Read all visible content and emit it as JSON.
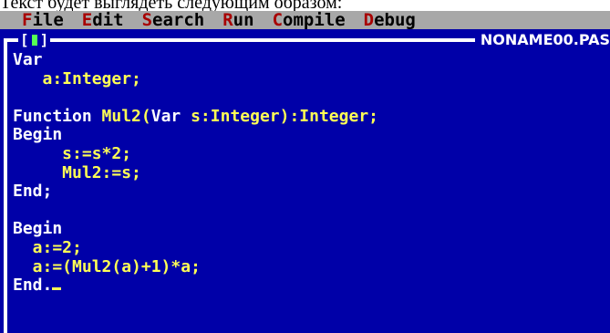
{
  "caption": "Текст будет выглядеть следующим образом:",
  "menu": [
    {
      "hot": "F",
      "rest": "ile"
    },
    {
      "hot": "E",
      "rest": "dit"
    },
    {
      "hot": "S",
      "rest": "earch"
    },
    {
      "hot": "R",
      "rest": "un"
    },
    {
      "hot": "C",
      "rest": "ompile"
    },
    {
      "hot": "D",
      "rest": "ebug"
    }
  ],
  "window": {
    "close_left": "[",
    "close_right": "]",
    "title": "NONAME00.PAS"
  },
  "code_lines": [
    [
      {
        "t": "Var",
        "c": "kw"
      }
    ],
    [
      {
        "t": "   a:Integer;",
        "c": "id"
      }
    ],
    [],
    [
      {
        "t": "Function ",
        "c": "kw"
      },
      {
        "t": "Mul2(",
        "c": "id"
      },
      {
        "t": "Var ",
        "c": "kw"
      },
      {
        "t": "s:Integer):Integer;",
        "c": "id"
      }
    ],
    [
      {
        "t": "Begin",
        "c": "kw"
      }
    ],
    [
      {
        "t": "     s:=s*2;",
        "c": "id"
      }
    ],
    [
      {
        "t": "     Mul2:=s;",
        "c": "id"
      }
    ],
    [
      {
        "t": "End;",
        "c": "kw"
      }
    ],
    [],
    [
      {
        "t": "Begin",
        "c": "kw"
      }
    ],
    [
      {
        "t": "  a:=2;",
        "c": "id"
      }
    ],
    [
      {
        "t": "  a:=(Mul2(a)+1)*a;",
        "c": "id"
      }
    ],
    [
      {
        "t": "End.",
        "c": "kw"
      }
    ]
  ],
  "colors": {
    "editor_background": "#0000a8",
    "menubar_background": "#a8a8a8",
    "hotkey": "#a80000",
    "keyword": "#ffffff",
    "identifier": "#ffff55",
    "close_button": "#55ff55"
  }
}
